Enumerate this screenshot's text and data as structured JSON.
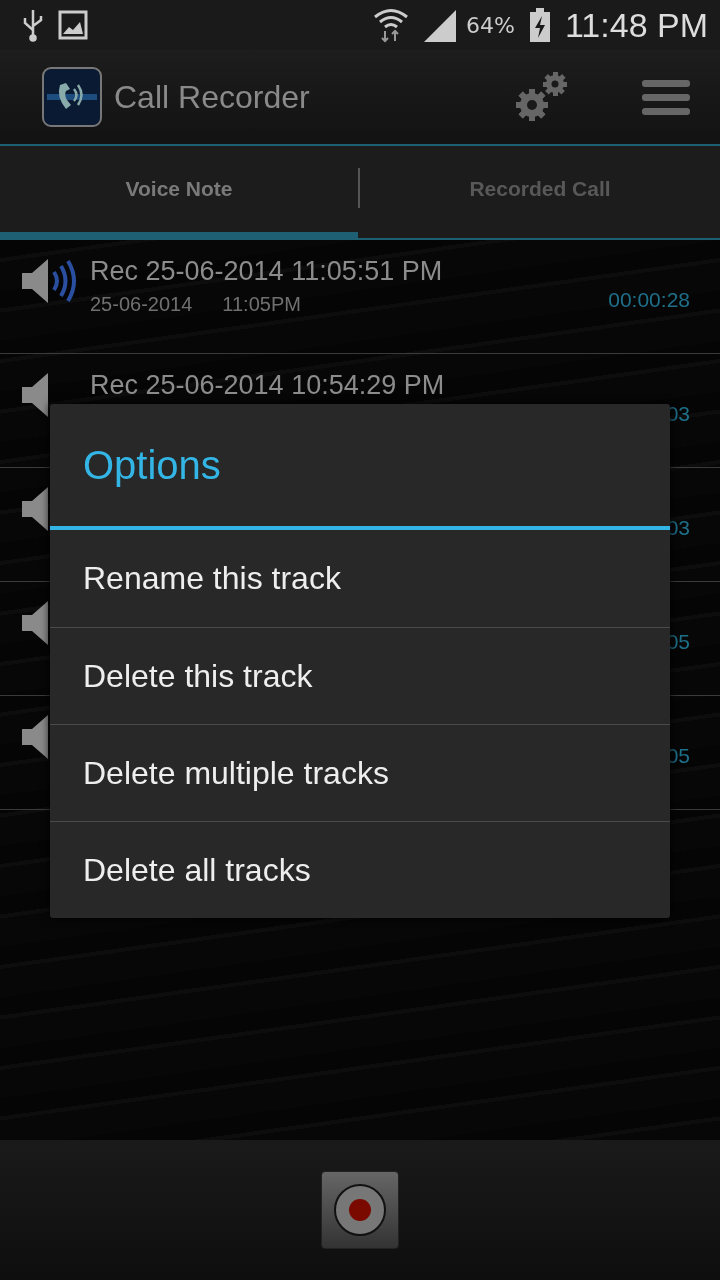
{
  "status_bar": {
    "battery": "64%",
    "time": "11:48 PM"
  },
  "app_bar": {
    "title": "Call Recorder"
  },
  "tabs": [
    {
      "label": "Voice Note",
      "selected": true
    },
    {
      "label": "Recorded Call",
      "selected": false
    }
  ],
  "recordings": [
    {
      "title": "Rec 25-06-2014  11:05:51 PM",
      "date": "25-06-2014",
      "time": "11:05PM",
      "duration": "00:00:28"
    },
    {
      "title": "Rec 25-06-2014  10:54:29 PM",
      "duration": "03"
    },
    {
      "duration": "03"
    },
    {
      "duration": "05"
    },
    {
      "duration": "05"
    }
  ],
  "dialog": {
    "title": "Options",
    "items": [
      "Rename this track",
      "Delete this track",
      "Delete multiple tracks",
      "Delete all tracks"
    ]
  }
}
